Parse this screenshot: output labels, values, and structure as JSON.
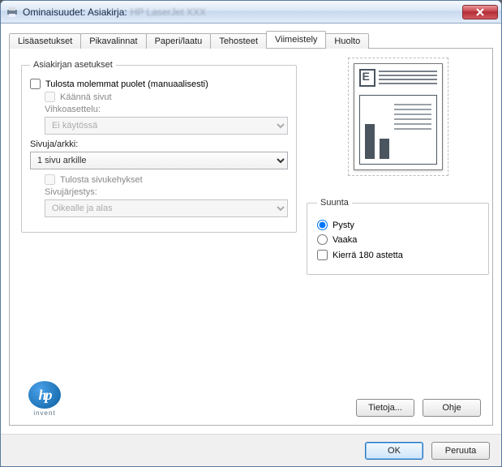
{
  "title": "Ominaisuudet: Asiakirja:",
  "printer_name_blurred": "HP LaserJet XXX",
  "tabs": {
    "items": [
      {
        "label": "Lisäasetukset"
      },
      {
        "label": "Pikavalinnat"
      },
      {
        "label": "Paperi/laatu"
      },
      {
        "label": "Tehosteet"
      },
      {
        "label": "Viimeistely"
      },
      {
        "label": "Huolto"
      }
    ],
    "active_index": 4
  },
  "doc_group": {
    "legend": "Asiakirjan asetukset",
    "print_both_sides": {
      "label": "Tulosta molemmat puolet (manuaalisesti)",
      "checked": false
    },
    "flip_pages": {
      "label": "Käännä sivut",
      "checked": false,
      "enabled": false
    },
    "booklet_layout_label": "Vihkoasettelu:",
    "booklet_layout_value": "Ei käytössä",
    "booklet_layout_enabled": false,
    "pages_per_sheet_label": "Sivuja/arkki:",
    "pages_per_sheet_value": "1 sivu arkille",
    "print_page_borders": {
      "label": "Tulosta sivukehykset",
      "checked": false,
      "enabled": false
    },
    "page_order_label": "Sivujärjestys:",
    "page_order_value": "Oikealle ja alas",
    "page_order_enabled": false
  },
  "orientation_group": {
    "legend": "Suunta",
    "portrait": {
      "label": "Pysty",
      "checked": true
    },
    "landscape": {
      "label": "Vaaka",
      "checked": false
    },
    "rotate180": {
      "label": "Kierrä 180 astetta",
      "checked": false
    }
  },
  "hp": {
    "invent": "invent",
    "logo_text": "hp"
  },
  "buttons": {
    "about": "Tietoja...",
    "help": "Ohje",
    "ok": "OK",
    "cancel": "Peruuta"
  }
}
